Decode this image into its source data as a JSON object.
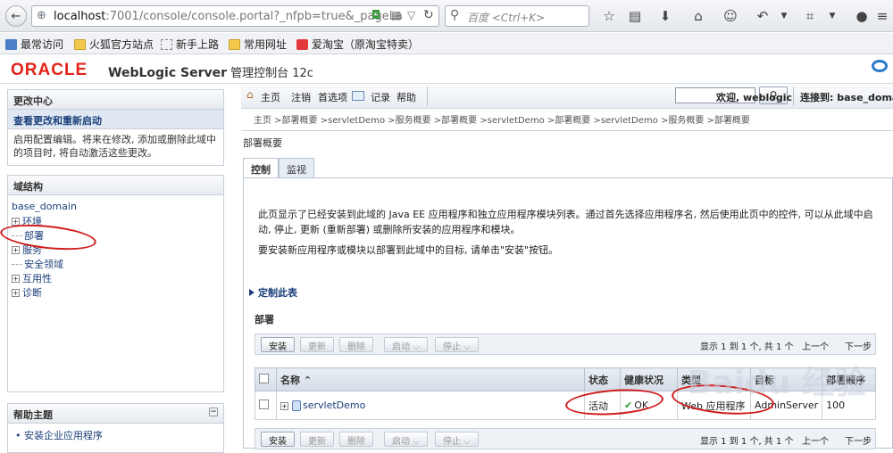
{
  "browser": {
    "url_host": "localhost",
    "url_rest": ":7001/console/console.portal?_nfpb=true&_pageLa",
    "search_placeholder": "百度 <Ctrl+K>"
  },
  "bookmarks": [
    {
      "label": "最常访问"
    },
    {
      "label": "火狐官方站点"
    },
    {
      "label": "新手上路"
    },
    {
      "label": "常用网址"
    },
    {
      "label": "爱淘宝（原淘宝特卖）"
    }
  ],
  "header": {
    "logo": "ORACLE",
    "product": "WebLogic Server",
    "product_suffix": " 管理控制台 12c"
  },
  "change_center": {
    "title": "更改中心",
    "link": "查看更改和重新启动",
    "description": "启用配置编辑。将来在修改, 添加或删除此域中的项目时, 将自动激活这些更改。"
  },
  "domain_structure": {
    "title": "域结构",
    "root": "base_domain",
    "items": [
      {
        "label": "环境",
        "expander": "+"
      },
      {
        "label": "部署",
        "expander": ""
      },
      {
        "label": "服务",
        "expander": "+"
      },
      {
        "label": "安全领域",
        "expander": ""
      },
      {
        "label": "互用性",
        "expander": "+"
      },
      {
        "label": "诊断",
        "expander": "+"
      }
    ]
  },
  "help_topics": {
    "title": "帮助主题",
    "collapse": "⊟",
    "item": "安装企业应用程序"
  },
  "top_nav": {
    "home": "主页",
    "logout": "注销",
    "preferences": "首选项",
    "record": "记录",
    "help": "帮助",
    "welcome": "欢迎, weblogic",
    "connected": "连接到: base_domain"
  },
  "breadcrumb": "主页 >部署概要 >servletDemo >服务概要 >部署概要 >servletDemo >部署概要 >servletDemo >服务概要 >部署概要",
  "main": {
    "title": "部署概要",
    "tabs": [
      {
        "label": "控制",
        "active": true
      },
      {
        "label": "监视",
        "active": false
      }
    ],
    "para1": "此页显示了已经安装到此域的 Java EE 应用程序和独立应用程序模块列表。通过首先选择应用程序名, 然后使用此页中的控件, 可以从此域中启动, 停止, 更新 (重新部署) 或删除所安装的应用程序和模块。",
    "para2": "要安装新应用程序或模块以部署到此域中的目标, 请单击\"安装\"按钮。",
    "customize": "定制此表",
    "deployments_title": "部署"
  },
  "toolbar": {
    "install": "安装",
    "update": "更新",
    "delete": "删除",
    "start": "启动 ⌵",
    "stop": "停止 ⌵",
    "pager_text": "显示 1 到 1 个, 共 1 个",
    "prev": "上一个",
    "next": "下一步"
  },
  "table": {
    "headers": [
      "",
      "名称 ⌃",
      "状态",
      "健康状况",
      "类型",
      "目标",
      "部署顺序"
    ],
    "rows": [
      {
        "name": "servletDemo",
        "state": "活动",
        "health": "OK",
        "type": "Web 应用程序",
        "target": "AdminServer",
        "order": "100"
      }
    ]
  },
  "watermark": "Baidu 经验",
  "colors": {
    "oracle_red": "#e2231a",
    "link_blue": "#1a3e7a",
    "annotation_red": "#d11a1a"
  }
}
